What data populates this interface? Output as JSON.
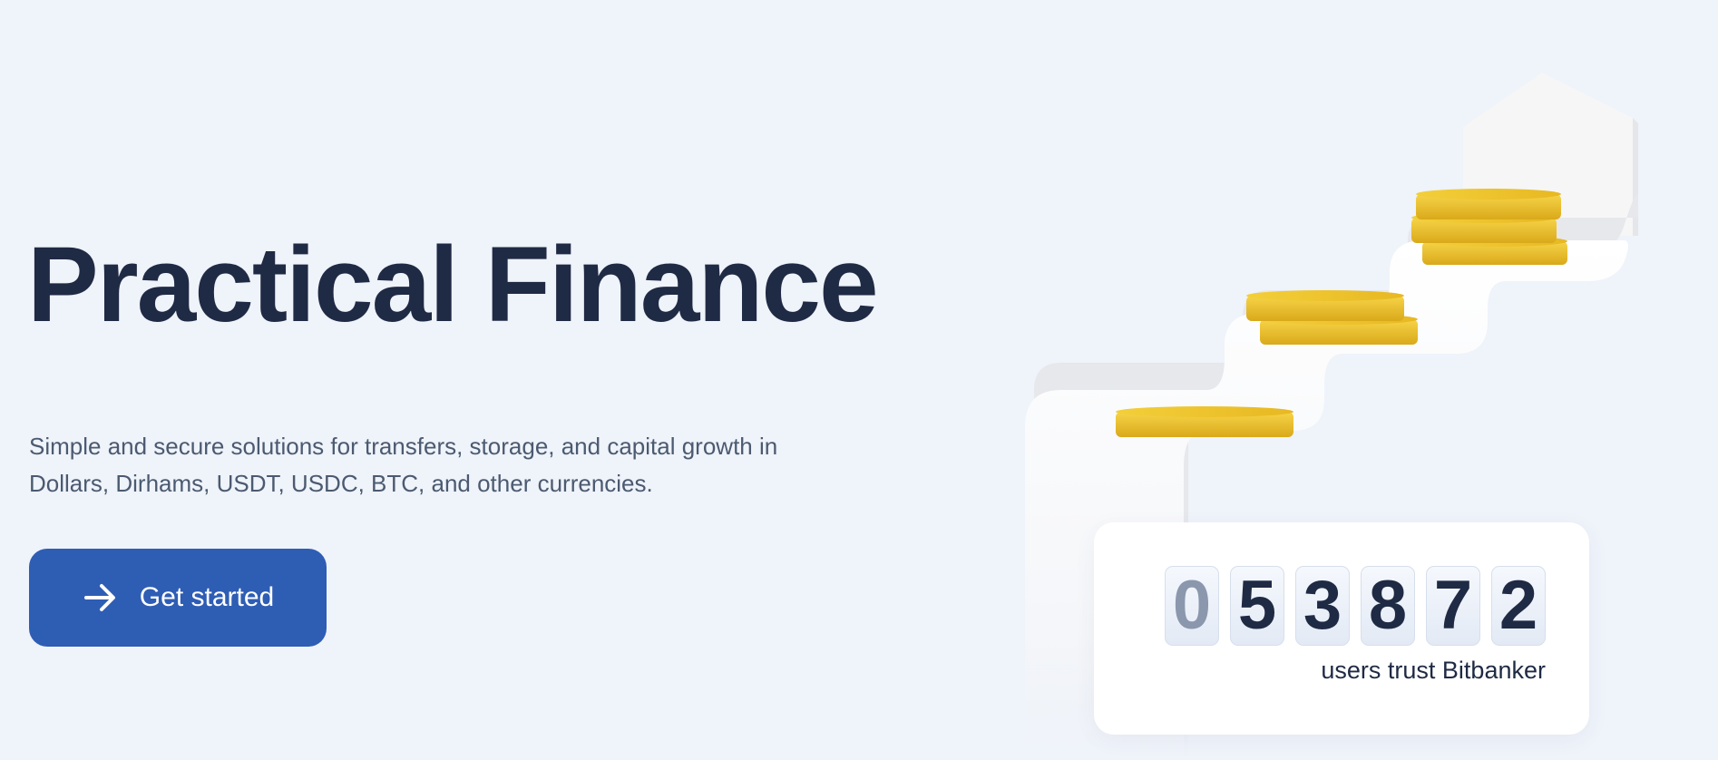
{
  "hero": {
    "title": "Practical Finance",
    "subtitle": "Simple and secure solutions for transfers, storage, and capital growth in Dollars, Dirhams, USDT, USDC, BTC, and other currencies.",
    "cta_label": "Get started",
    "cta_icon": "arrow-right-icon"
  },
  "counter": {
    "digits": [
      "0",
      "5",
      "3",
      "8",
      "7",
      "2"
    ],
    "label": "users trust Bitbanker"
  },
  "colors": {
    "background": "#eff3fa",
    "title": "#1f2a44",
    "subtitle": "#4b5a70",
    "primary": "#2e5db4",
    "coin": "#f1c62e"
  }
}
